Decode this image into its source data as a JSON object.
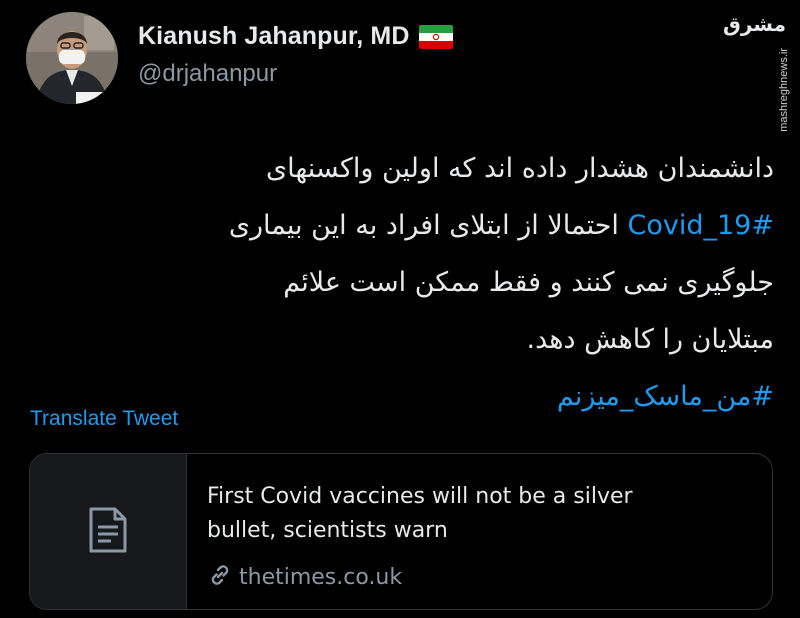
{
  "author": {
    "display_name": "Kianush Jahanpur, MD",
    "handle": "@drjahanpur",
    "flag_icon": "iran-flag-icon"
  },
  "watermark": {
    "logo_text": "مشرق",
    "url": "mashreghnews.ir"
  },
  "tweet": {
    "lines": [
      "دانشمندان هشدار داده اند که اولین واکسنهای",
      "احتمالا از ابتلای افراد به این بیماری",
      "جلوگیری نمی کنند و فقط ممکن است علائم",
      "مبتلایان را کاهش دهد."
    ],
    "hashtag_covid": "#Covid_19",
    "hashtag_mask": "#من_ماسک_میزنم",
    "translate_label": "Translate Tweet"
  },
  "link_card": {
    "thumb_icon": "document-icon",
    "title": "First Covid vaccines will not be a silver bullet, scientists warn",
    "domain_icon": "link-icon",
    "domain": "thetimes.co.uk"
  },
  "colors": {
    "background": "#000000",
    "text": "#e7e9ea",
    "secondary_text": "#8b98a5",
    "accent": "#1d9bf0",
    "border": "#2f3336"
  }
}
